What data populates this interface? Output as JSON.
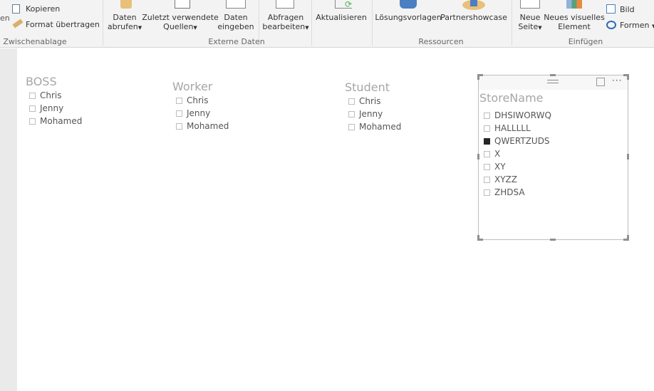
{
  "ribbon": {
    "clipboard": {
      "partial": "en",
      "copy": "Kopieren",
      "format": "Format übertragen",
      "group": "Zwischenablage"
    },
    "external": {
      "group": "Externe Daten",
      "get_data": [
        "Daten",
        "abrufen"
      ],
      "recent": [
        "Zuletzt verwendete",
        "Quellen"
      ],
      "enter": [
        "Daten",
        "eingeben"
      ],
      "edit": [
        "Abfragen",
        "bearbeiten"
      ],
      "refresh": "Aktualisieren"
    },
    "resources": {
      "group": "Ressourcen",
      "templates": "Lösungsvorlagen",
      "partner": "Partnershowcase"
    },
    "insert": {
      "group": "Einfügen",
      "new_page": [
        "Neue",
        "Seite"
      ],
      "new_visual": [
        "Neues visuelles",
        "Element"
      ],
      "image": "Bild",
      "shapes": "Formen"
    }
  },
  "slicers": [
    {
      "title": "BOSS",
      "items": [
        "Chris",
        "Jenny",
        "Mohamed"
      ]
    },
    {
      "title": "Worker",
      "items": [
        "Chris",
        "Jenny",
        "Mohamed"
      ]
    },
    {
      "title": "Student",
      "items": [
        "Chris",
        "Jenny",
        "Mohamed"
      ]
    }
  ],
  "store_slicer": {
    "title": "StoreName",
    "items": [
      "DHSIWORWQ",
      "HALLLLL",
      "QWERTZUDS",
      "X",
      "XY",
      "XYZZ",
      "ZHDSA"
    ],
    "selected": "QWERTZUDS"
  }
}
